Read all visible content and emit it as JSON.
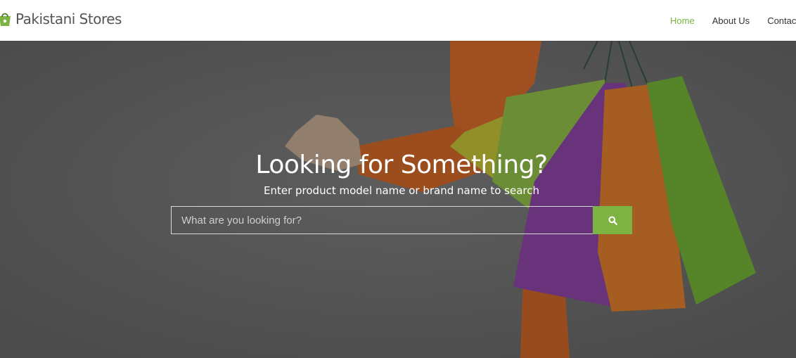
{
  "brand": {
    "name": "Pakistani Stores",
    "logo_icon": "shopping-bag-icon",
    "logo_color": "#7cb342"
  },
  "nav": {
    "items": [
      {
        "label": "Home",
        "active": true
      },
      {
        "label": "About Us",
        "active": false
      },
      {
        "label": "Contact",
        "active": false
      }
    ]
  },
  "hero": {
    "title": "Looking for Something?",
    "subtitle": "Enter product model name or brand name to search"
  },
  "search": {
    "placeholder": "What are you looking for?",
    "value": "",
    "button_icon": "search-icon"
  },
  "colors": {
    "accent": "#7cb342",
    "text_dark": "#333333"
  }
}
